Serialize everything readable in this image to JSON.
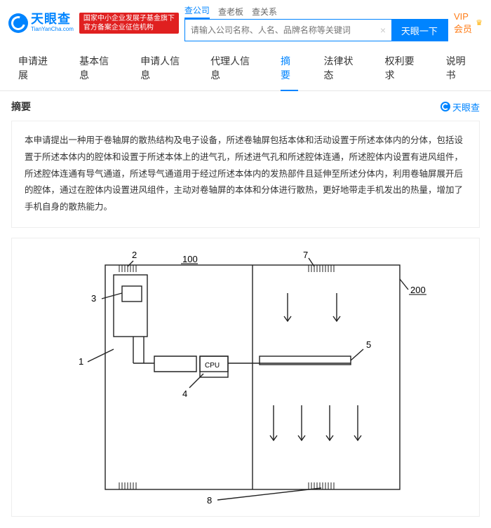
{
  "header": {
    "logo_main": "天眼查",
    "logo_sub": "TianYanCha.com",
    "red_badge_line1": "国家中小企业发展子基金旗下",
    "red_badge_line2": "官方备案企业征信机构",
    "search_tabs": [
      "查公司",
      "查老板",
      "查关系"
    ],
    "search_placeholder": "请输入公司名称、人名、品牌名称等关键词",
    "search_btn": "天眼一下",
    "vip_label": "VIP会员"
  },
  "nav": {
    "items": [
      "申请进展",
      "基本信息",
      "申请人信息",
      "代理人信息",
      "摘要",
      "法律状态",
      "权利要求",
      "说明书"
    ],
    "active_index": 4
  },
  "section": {
    "title": "摘要",
    "watermark": "天眼查"
  },
  "abstract": "本申请提出一种用于卷轴屏的散热结构及电子设备，所述卷轴屏包括本体和活动设置于所述本体内的分体，包括设置于所述本体内的腔体和设置于所述本体上的进气孔，所述进气孔和所述腔体连通，所述腔体内设置有进风组件，所述腔体连通有导气通道，所述导气通道用于经过所述本体内的发热部件且延伸至所述分体内，利用卷轴屏展开后的腔体，通过在腔体内设置进风组件，主动对卷轴屏的本体和分体进行散热，更好地带走手机发出的热量，增加了手机自身的散热能力。",
  "figure": {
    "labels": {
      "l1": "1",
      "l2": "2",
      "l3": "3",
      "l4": "4",
      "l5": "5",
      "l7": "7",
      "l8": "8",
      "l100": "100",
      "l200": "200",
      "cpu": "CPU"
    }
  }
}
